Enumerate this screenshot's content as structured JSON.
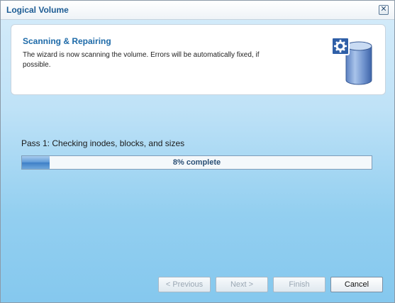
{
  "window": {
    "title": "Logical Volume"
  },
  "header": {
    "title": "Scanning & Repairing",
    "description": "The wizard is now scanning the volume. Errors will be automatically fixed, if possible.",
    "icon": "volume-gear-icon"
  },
  "progress": {
    "pass_label": "Pass 1: Checking inodes, blocks, and sizes",
    "percent": 8,
    "text": "8% complete"
  },
  "buttons": {
    "previous": "< Previous",
    "next": "Next >",
    "finish": "Finish",
    "cancel": "Cancel"
  },
  "colors": {
    "title": "#1d5c94",
    "accent": "#1d6aa8",
    "progress_fill": "#5c98d6"
  }
}
